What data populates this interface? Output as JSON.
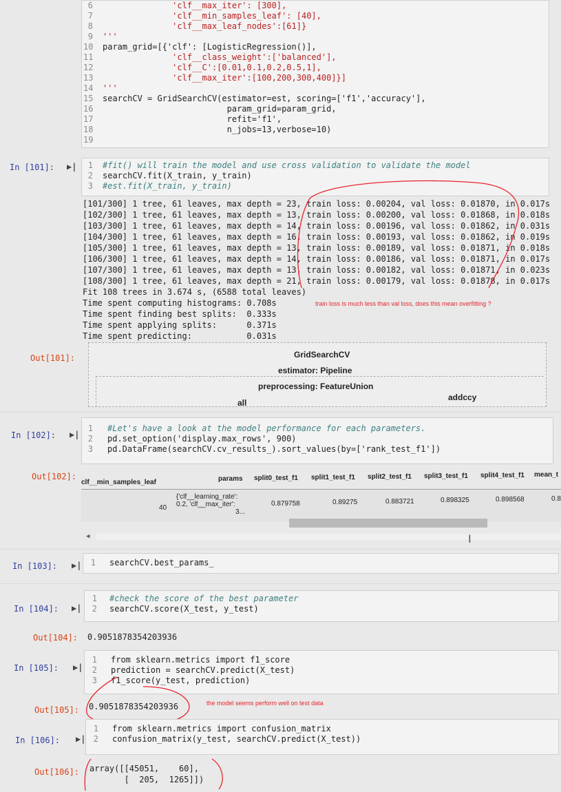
{
  "cell_top": {
    "gutter": [
      "6",
      "7",
      "8",
      "9",
      "10",
      "11",
      "12",
      "13",
      "14",
      "15",
      "16",
      "17",
      "18",
      "19"
    ],
    "lines": [
      "              'clf__max_iter': [300],",
      "              'clf__min_samples_leaf': [40],",
      "              'clf__max_leaf_nodes':[61]}",
      "'''",
      "param_grid=[{'clf': [LogisticRegression()],",
      "              'clf__class_weight':['balanced'],",
      "              'clf__C':[0.01,0.1,0.2,0.5,1],",
      "              'clf__max_iter':[100,200,300,400]}]",
      "'''",
      "searchCV = GridSearchCV(estimator=est, scoring=['f1','accuracy'],",
      "                         param_grid=param_grid,",
      "                         refit='f1',",
      "                         n_jobs=13,verbose=10)",
      ""
    ]
  },
  "cell101": {
    "prompt": "In [101]:",
    "gutter": [
      "1",
      "2",
      "3"
    ],
    "lines": [
      "#fit() will train the model and use cross validation to validate the model",
      "searchCV.fit(X_train, y_train)",
      "#est.fit(X_train, y_train)"
    ],
    "stream": [
      "[101/300] 1 tree, 61 leaves, max depth = 23, train loss: 0.00204, val loss: 0.01870, in 0.017s",
      "[102/300] 1 tree, 61 leaves, max depth = 13, train loss: 0.00200, val loss: 0.01868, in 0.018s",
      "[103/300] 1 tree, 61 leaves, max depth = 14, train loss: 0.00196, val loss: 0.01862, in 0.031s",
      "[104/300] 1 tree, 61 leaves, max depth = 16, train loss: 0.00193, val loss: 0.01862, in 0.019s",
      "[105/300] 1 tree, 61 leaves, max depth = 13, train loss: 0.00189, val loss: 0.01871, in 0.018s",
      "[106/300] 1 tree, 61 leaves, max depth = 14, train loss: 0.00186, val loss: 0.01871, in 0.017s",
      "[107/300] 1 tree, 61 leaves, max depth = 13, train loss: 0.00182, val loss: 0.01871, in 0.023s",
      "[108/300] 1 tree, 61 leaves, max depth = 21, train loss: 0.00179, val loss: 0.01878, in 0.017s",
      "Fit 108 trees in 3.674 s, (6588 total leaves)",
      "Time spent computing histograms: 0.708s",
      "Time spent finding best splits:  0.333s",
      "Time spent applying splits:      0.371s",
      "Time spent predicting:           0.031s"
    ],
    "annotation": "train loss is much less than val loss, does this mean overfitting ?",
    "out_prompt": "Out[101]:",
    "diagram": {
      "title": "GridSearchCV",
      "estimator": "estimator: Pipeline",
      "preprocessing": "preprocessing: FeatureUnion",
      "left": "all",
      "right": "addccy"
    }
  },
  "cell102": {
    "prompt": "In [102]:",
    "gutter": [
      "1",
      "2",
      "3"
    ],
    "lines": [
      "#Let's have a look at the model performance for each parameters.",
      "pd.set_option('display.max_rows', 900)",
      "pd.DataFrame(searchCV.cv_results_).sort_values(by=['rank_test_f1'])"
    ],
    "out_prompt": "Out[102]:",
    "table": {
      "headers": [
        "clf__min_samples_leaf",
        "params",
        "split0_test_f1",
        "split1_test_f1",
        "split2_test_f1",
        "split3_test_f1",
        "split4_test_f1",
        "mean_t"
      ],
      "row": {
        "min_samples_leaf": "40",
        "params_l1": "{'clf__learning_rate':",
        "params_l2": "0.2, 'clf__max_iter':",
        "params_l3": "3...",
        "values": [
          "0.879758",
          "0.89275",
          "0.883721",
          "0.898325",
          "0.898568",
          "0.8"
        ]
      }
    }
  },
  "cell103": {
    "prompt": "In [103]:",
    "gutter": [
      "1"
    ],
    "lines": [
      "searchCV.best_params_"
    ]
  },
  "cell104": {
    "prompt": "In [104]:",
    "gutter": [
      "1",
      "2"
    ],
    "lines": [
      "#check the score of the best parameter",
      "searchCV.score(X_test, y_test)"
    ],
    "out_prompt": "Out[104]:",
    "out": "0.9051878354203936"
  },
  "cell105": {
    "prompt": "In [105]:",
    "gutter": [
      "1",
      "2",
      "3"
    ],
    "lines": [
      "from sklearn.metrics import f1_score",
      "prediction = searchCV.predict(X_test)",
      "f1_score(y_test, prediction)"
    ],
    "out_prompt": "Out[105]:",
    "out": "0.9051878354203936",
    "annotation": "the model seems perform well on test data"
  },
  "cell106": {
    "prompt": "In [106]:",
    "gutter": [
      "1",
      "2"
    ],
    "lines": [
      "from sklearn.metrics import confusion_matrix",
      "confusion_matrix(y_test, searchCV.predict(X_test))"
    ],
    "out_prompt": "Out[106]:",
    "out_l1": "array([[45051,    60],",
    "out_l2": "       [  205,  1265]])"
  },
  "colors": {
    "annotation": "#e8242c",
    "in_prompt": "#303f9f",
    "out_prompt": "#d84315"
  }
}
